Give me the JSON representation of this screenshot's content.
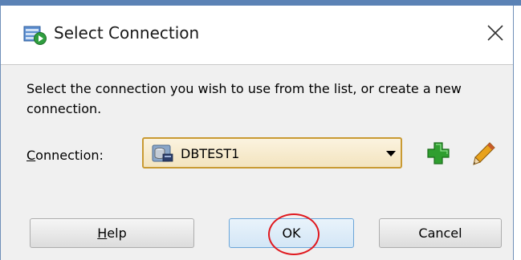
{
  "dialog": {
    "title": "Select Connection",
    "message": "Select the connection you wish to use from the list, or create a new connection."
  },
  "connection": {
    "label_mnemonic": "C",
    "label_rest": "onnection:",
    "selected": "DBTEST1"
  },
  "buttons": {
    "help_mnemonic": "H",
    "help_rest": "elp",
    "ok": "OK",
    "cancel": "Cancel"
  },
  "icons": {
    "app": "database-run-icon",
    "close": "close-icon",
    "connection": "database-connection-icon",
    "dropdown": "chevron-down-icon",
    "add": "plus-icon",
    "edit": "pencil-icon"
  },
  "colors": {
    "accent_blue": "#5b82b5",
    "combo_border": "#c99a33",
    "add_green": "#2f9e2f",
    "highlight_red": "#e0191f"
  }
}
